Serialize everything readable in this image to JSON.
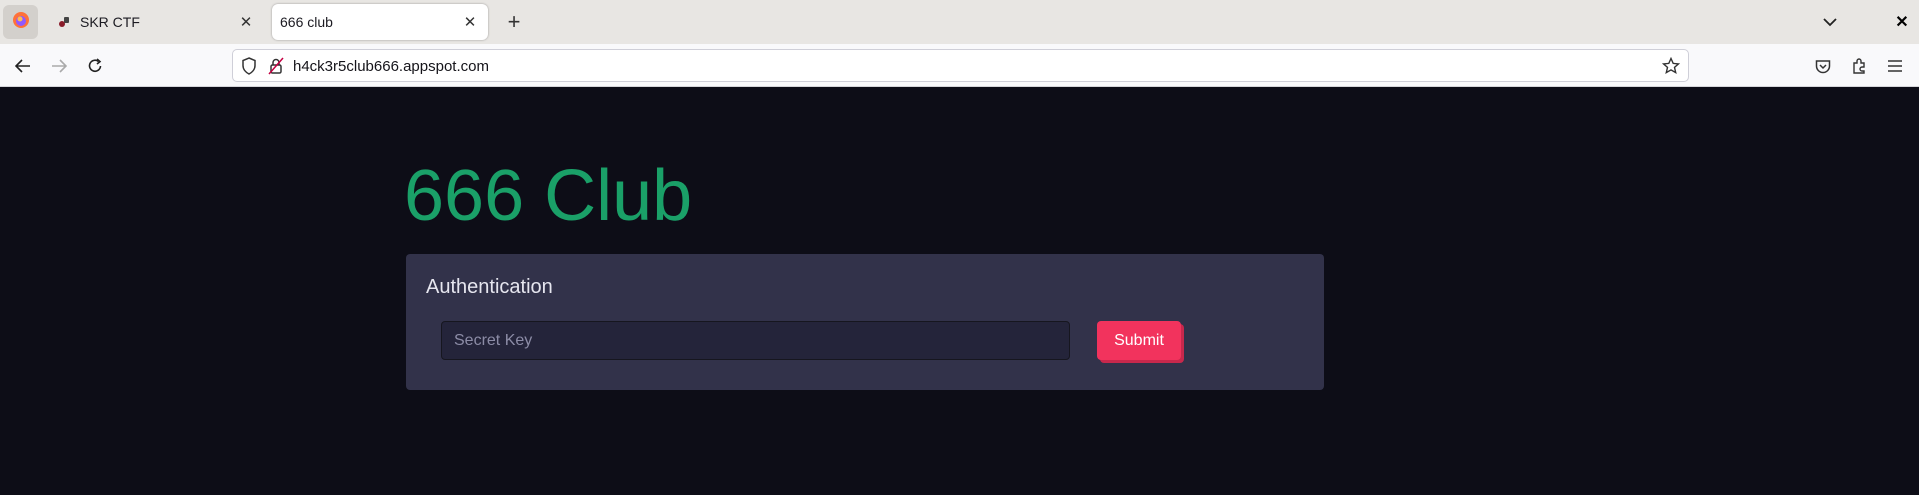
{
  "browser": {
    "tabs": [
      {
        "title": "SKR CTF",
        "active": false
      },
      {
        "title": "666 club",
        "active": true
      }
    ],
    "url": "h4ck3r5club666.appspot.com"
  },
  "page": {
    "heading": "666 Club",
    "auth_card": {
      "title": "Authentication",
      "input_placeholder": "Secret Key",
      "input_value": "",
      "submit_label": "Submit"
    }
  },
  "colors": {
    "page_bg": "#0d0d17",
    "heading": "#1aa068",
    "card_bg": "#32324a",
    "submit_bg": "#f2335d"
  },
  "icons": [
    "firefox-menu-icon",
    "skr-favicon-icon",
    "close-icon",
    "plus-icon",
    "chevron-down-icon",
    "back-arrow-icon",
    "forward-arrow-icon",
    "reload-icon",
    "shield-icon",
    "insecure-lock-icon",
    "star-icon",
    "pocket-icon",
    "extensions-icon",
    "hamburger-menu-icon"
  ]
}
